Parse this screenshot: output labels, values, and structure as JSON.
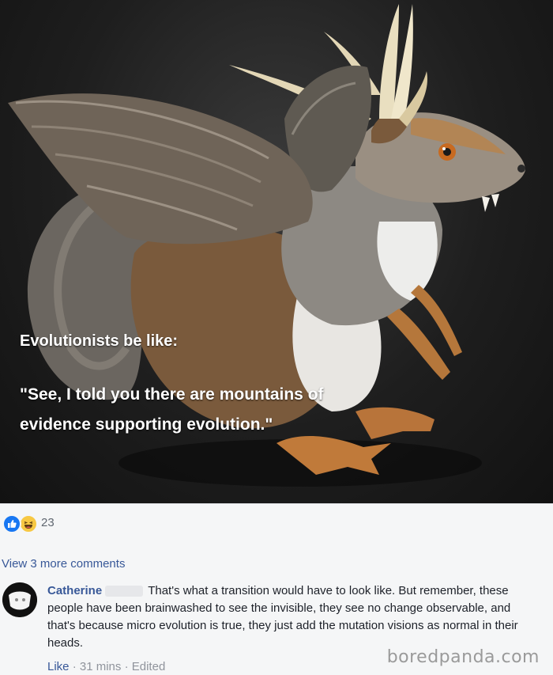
{
  "meme": {
    "caption_title": "Evolutionists be like:",
    "caption_quote": "\"See, I told you there are mountains of evidence supporting evolution.\""
  },
  "reactions": {
    "icons": [
      "like-icon",
      "haha-icon"
    ],
    "count": "23",
    "colors": {
      "like": "#1877f2",
      "haha": "#f7c843"
    }
  },
  "comments": {
    "view_more": "View 3 more comments",
    "items": [
      {
        "author": "Catherine",
        "text": "That's what a transition would have to look like. But remember, these people have been brainwashed to see the invisible, they see no change observable, and that's because micro evolution is true, they just add the mutation visions as normal in their heads.",
        "like_label": "Like",
        "time": "31 mins",
        "edited": "Edited"
      }
    ]
  },
  "watermark": "boredpanda.com",
  "theme": {
    "link": "#385898",
    "background": "#f5f6f7",
    "muted": "#90949c"
  }
}
